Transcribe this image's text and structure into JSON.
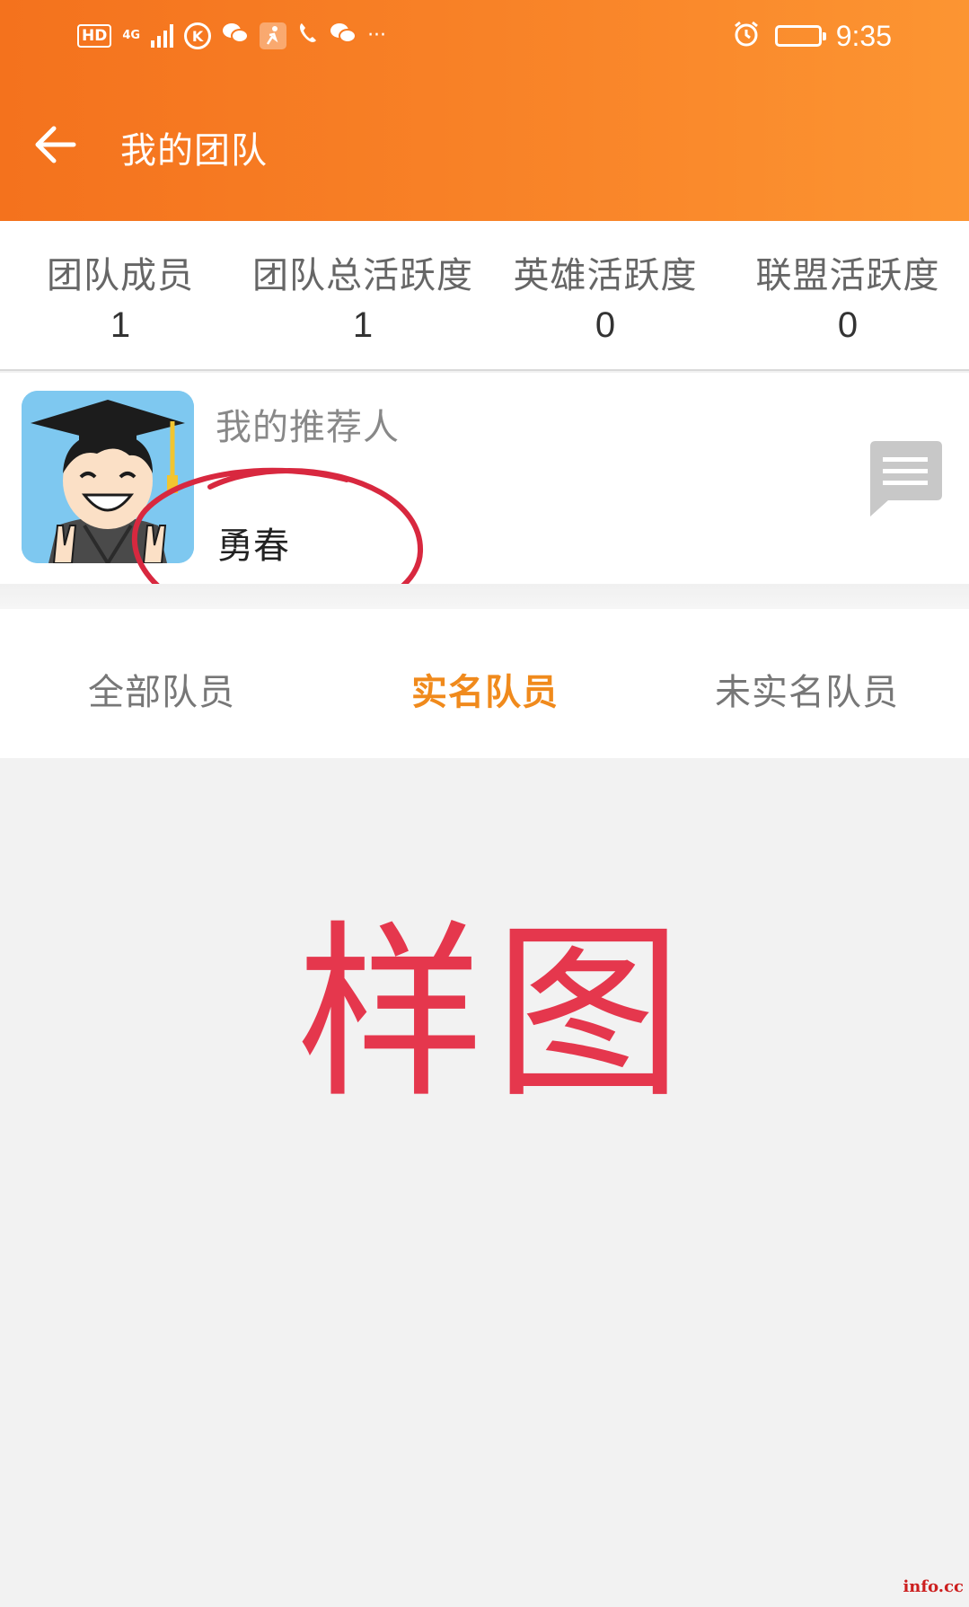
{
  "status_bar": {
    "hd": "HD",
    "network": "4G",
    "carrier_icon": "K",
    "time": "9:35",
    "more": "···"
  },
  "nav": {
    "title": "我的团队"
  },
  "stats": [
    {
      "label": "团队成员",
      "value": "1"
    },
    {
      "label": "团队总活跃度",
      "value": "1"
    },
    {
      "label": "英雄活跃度",
      "value": "0"
    },
    {
      "label": "联盟活跃度",
      "value": "0"
    }
  ],
  "referrer": {
    "label": "我的推荐人",
    "name": "勇春"
  },
  "tabs": [
    {
      "label": "全部队员",
      "active": false
    },
    {
      "label": "实名队员",
      "active": true
    },
    {
      "label": "未实名队员",
      "active": false
    }
  ],
  "overlay": {
    "sample_text": "样图",
    "corner_mark": "info.cc"
  },
  "colors": {
    "header_start": "#f4721d",
    "header_end": "#fc9532",
    "active_tab": "#f08a1c",
    "annotation_red": "#d8283f"
  }
}
